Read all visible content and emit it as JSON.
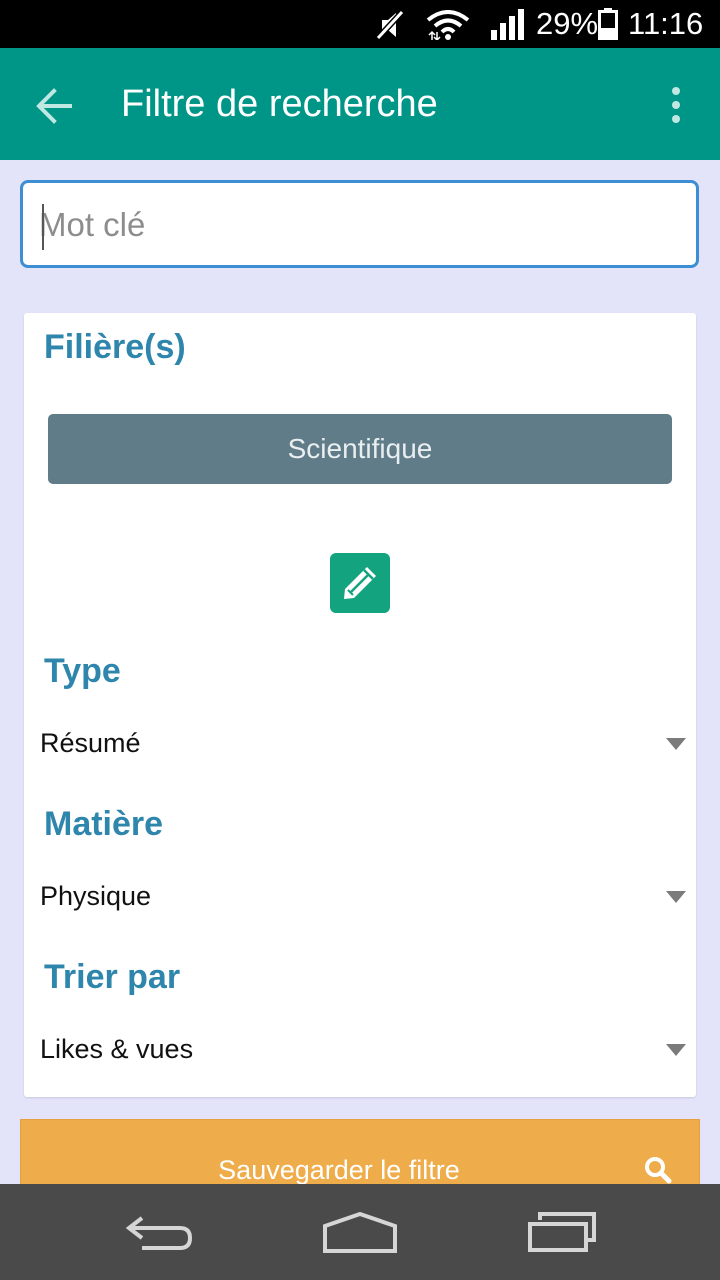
{
  "status_bar": {
    "battery_percent": "29%",
    "time": "11:16",
    "icons": [
      "mute-icon",
      "wifi-icon",
      "signal-icon",
      "battery-icon"
    ]
  },
  "app_bar": {
    "title": "Filtre de recherche",
    "back_icon": "arrow-back-icon",
    "menu_icon": "more-vert-icon",
    "color": "#009687"
  },
  "search": {
    "placeholder": "Mot clé",
    "value": ""
  },
  "filters": {
    "filieres": {
      "label": "Filière(s)",
      "selected": [
        "Scientifique"
      ],
      "edit_icon": "pencil-icon"
    },
    "type": {
      "label": "Type",
      "value": "Résumé"
    },
    "matiere": {
      "label": "Matière",
      "value": "Physique"
    },
    "trier_par": {
      "label": "Trier par",
      "value": "Likes & vues"
    }
  },
  "save_button": {
    "label": "Sauvegarder le filtre",
    "icon": "search-icon",
    "color": "#efac4b"
  },
  "nav_bar": {
    "icons": [
      "back-icon",
      "home-icon",
      "recents-icon"
    ]
  },
  "colors": {
    "section_title": "#2e86ac",
    "chip": "#607c89",
    "edit_button": "#14a37f",
    "background": "#e3e4fa",
    "input_border": "#3d8ed2"
  }
}
